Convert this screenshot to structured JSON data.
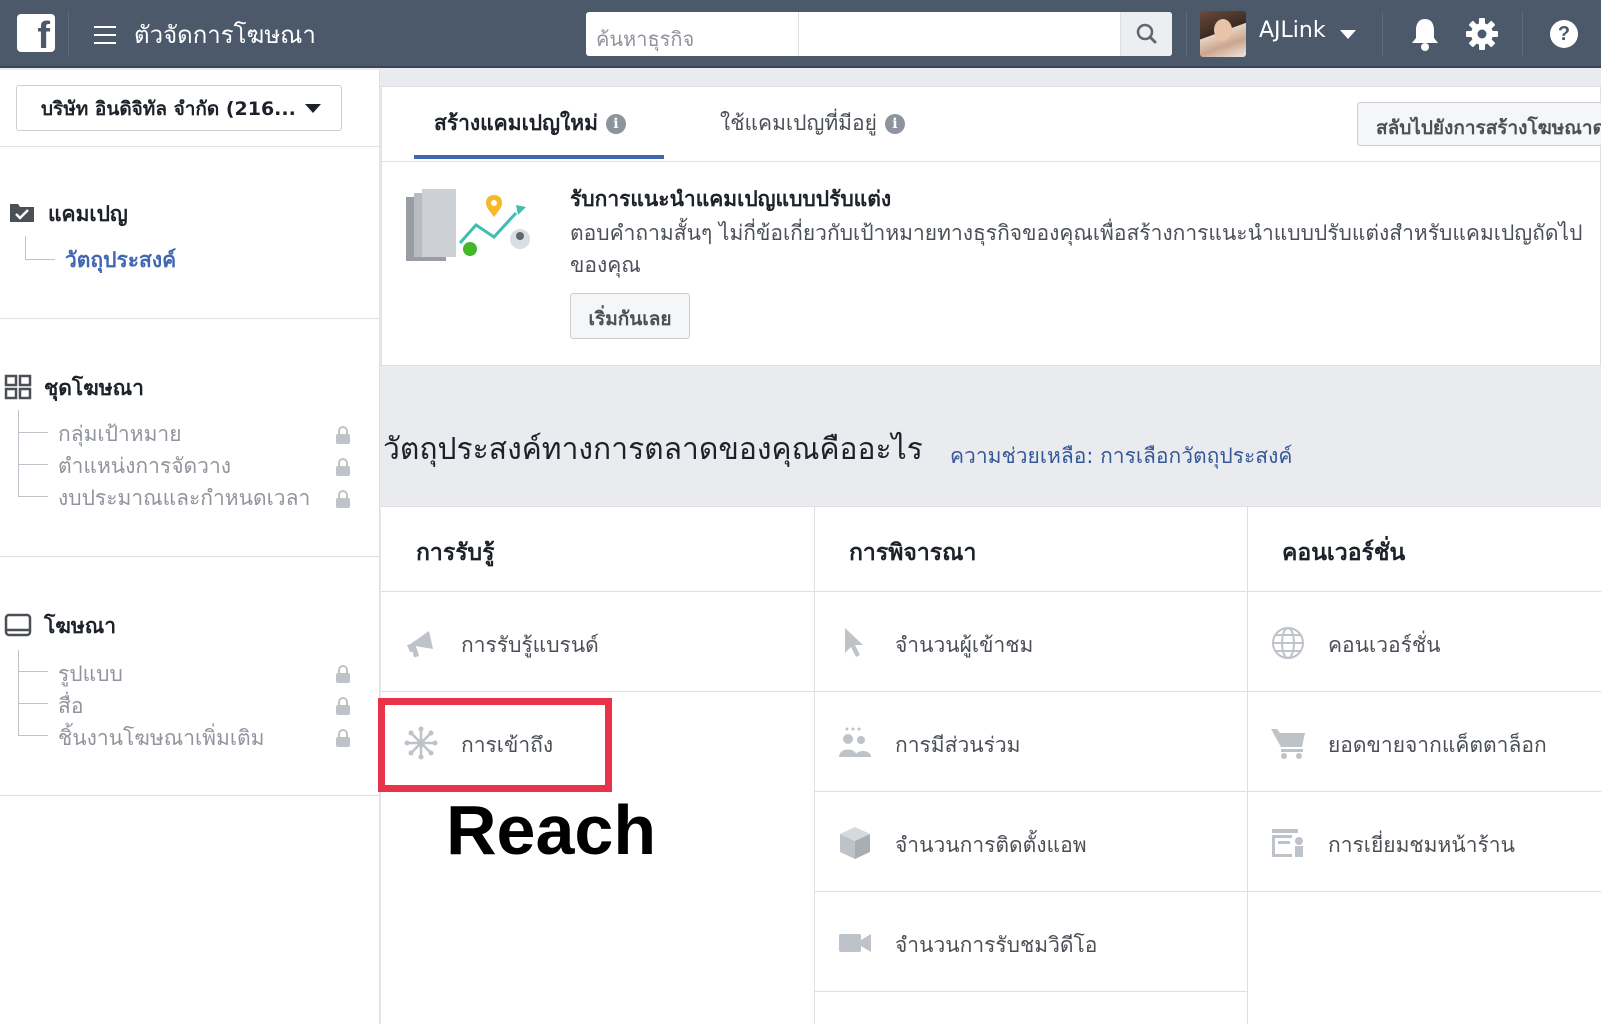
{
  "header": {
    "logo_letter": "f",
    "app_title": "ตัวจัดการโฆษณา",
    "search_placeholder": "ค้นหาธุรกิจ",
    "user_name": "AJLink",
    "help_glyph": "?"
  },
  "sidebar": {
    "account_selector": "บริษัท อินดิจิทัล จำกัด (216...",
    "campaign": {
      "label": "แคมเปญ",
      "items": [
        {
          "label": "วัตถุประสงค์",
          "active": true
        }
      ]
    },
    "ad_set": {
      "label": "ชุดโฆษณา",
      "items": [
        {
          "label": "กลุ่มเป้าหมาย",
          "locked": true
        },
        {
          "label": "ตำแหน่งการจัดวาง",
          "locked": true
        },
        {
          "label": "งบประมาณและกำหนดเวลา",
          "locked": true
        }
      ]
    },
    "ad": {
      "label": "โฆษณา",
      "items": [
        {
          "label": "รูปแบบ",
          "locked": true
        },
        {
          "label": "สื่อ",
          "locked": true
        },
        {
          "label": "ชิ้นงานโฆษณาเพิ่มเติม",
          "locked": true
        }
      ]
    }
  },
  "tabs": {
    "create_new": "สร้างแคมเปญใหม่",
    "use_existing": "ใช้แคมเปญที่มีอยู่",
    "switch_button": "สลับไปยังการสร้างโฆษณาด่วน"
  },
  "recommendation": {
    "title": "รับการแนะนำแคมเปญแบบปรับแต่ง",
    "description": "ตอบคำถามสั้นๆ ไม่กี่ข้อเกี่ยวกับเป้าหมายทางธุรกิจของคุณเพื่อสร้างการแนะนำแบบปรับแต่งสำหรับแคมเปญถัดไปของคุณ",
    "button": "เริ่มกันเลย"
  },
  "objectives": {
    "title": "วัตถุประสงค์ทางการตลาดของคุณคืออะไร",
    "help_link": "ความช่วยเหลือ: การเลือกวัตถุประสงค์",
    "columns": [
      {
        "heading": "การรับรู้",
        "items": [
          {
            "label": "การรับรู้แบรนด์",
            "icon": "megaphone-icon"
          },
          {
            "label": "การเข้าถึง",
            "icon": "reach-icon"
          }
        ]
      },
      {
        "heading": "การพิจารณา",
        "items": [
          {
            "label": "จำนวนผู้เข้าชม",
            "icon": "cursor-icon"
          },
          {
            "label": "การมีส่วนร่วม",
            "icon": "people-icon"
          },
          {
            "label": "จำนวนการติดตั้งแอพ",
            "icon": "box-icon"
          },
          {
            "label": "จำนวนการรับชมวิดีโอ",
            "icon": "video-camera-icon"
          }
        ]
      },
      {
        "heading": "คอนเวอร์ชั่น",
        "items": [
          {
            "label": "คอนเวอร์ชั่น",
            "icon": "globe-icon"
          },
          {
            "label": "ยอดขายจากแค็ตตาล็อก",
            "icon": "cart-icon"
          },
          {
            "label": "การเยี่ยมชมหน้าร้าน",
            "icon": "store-icon"
          }
        ]
      }
    ]
  },
  "annotation": {
    "text": "Reach",
    "color": "#e8334a"
  },
  "colors": {
    "topbar": "#4b596b",
    "accent": "#4267b2",
    "icon_gray": "#bec2c9"
  }
}
